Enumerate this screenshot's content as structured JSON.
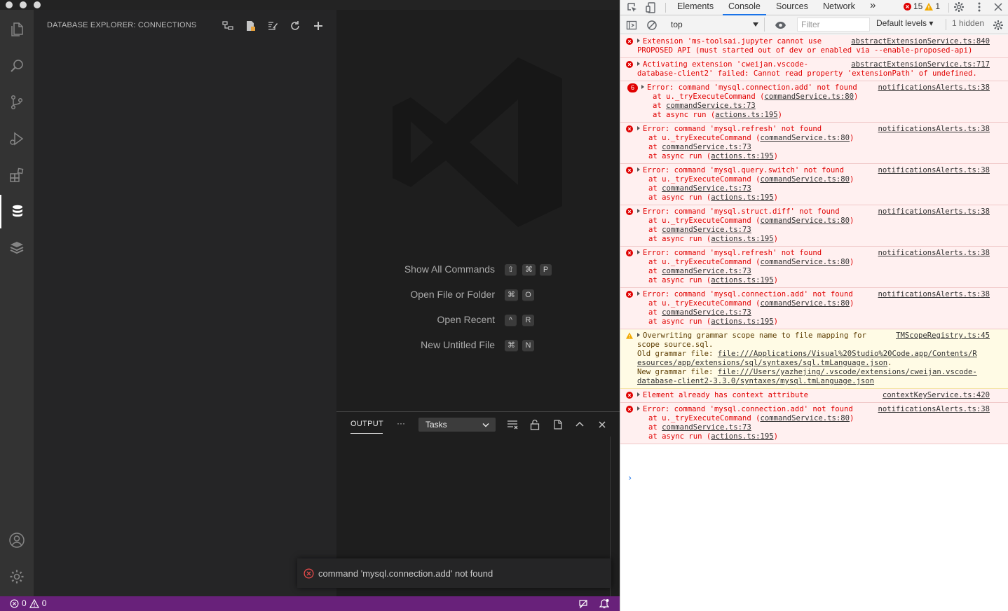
{
  "vscode": {
    "sidebar": {
      "title": "DATABASE EXPLORER: CONNECTIONS"
    },
    "commands": [
      {
        "label": "Show All Commands",
        "keys": [
          "⇧",
          "⌘",
          "P"
        ]
      },
      {
        "label": "Open File or Folder",
        "keys": [
          "⌘",
          "O"
        ]
      },
      {
        "label": "Open Recent",
        "keys": [
          "^",
          "R"
        ]
      },
      {
        "label": "New Untitled File",
        "keys": [
          "⌘",
          "N"
        ]
      }
    ],
    "panel": {
      "tab": "OUTPUT",
      "more": "···",
      "tasks_value": "Tasks"
    },
    "toast": {
      "message": "command 'mysql.connection.add' not found"
    },
    "status": {
      "errors": "0",
      "warnings": "0"
    }
  },
  "devtools": {
    "tabs": [
      "Elements",
      "Console",
      "Sources",
      "Network"
    ],
    "overflow": "»",
    "error_count": "15",
    "warning_count": "1",
    "context": "top",
    "filter_placeholder": "Filter",
    "levels": "Default levels ▾",
    "hidden": "1 hidden",
    "messages": [
      {
        "type": "error",
        "source": "abstractExtensionService.ts:840",
        "lines": [
          "Extension 'ms-toolsai.jupyter cannot use",
          "PROPOSED API (must started out of dev or enabled via --enable-proposed-api)"
        ]
      },
      {
        "type": "error",
        "source": "abstractExtensionService.ts:717",
        "lines": [
          "Activating extension 'cweijan.vscode-",
          "database-client2' failed: Cannot read property 'extensionPath' of undefined."
        ]
      },
      {
        "type": "error",
        "count": "6",
        "source": "notificationsAlerts.ts:38",
        "lines": [
          "Error: command 'mysql.connection.add' not found",
          "    at u._tryExecuteCommand (commandService.ts:80)",
          "    at commandService.ts:73",
          "    at async run (actions.ts:195)"
        ]
      },
      {
        "type": "error",
        "source": "notificationsAlerts.ts:38",
        "lines": [
          "Error: command 'mysql.refresh' not found",
          "    at u._tryExecuteCommand (commandService.ts:80)",
          "    at commandService.ts:73",
          "    at async run (actions.ts:195)"
        ]
      },
      {
        "type": "error",
        "source": "notificationsAlerts.ts:38",
        "lines": [
          "Error: command 'mysql.query.switch' not found",
          "    at u._tryExecuteCommand (commandService.ts:80)",
          "    at commandService.ts:73",
          "    at async run (actions.ts:195)"
        ]
      },
      {
        "type": "error",
        "source": "notificationsAlerts.ts:38",
        "lines": [
          "Error: command 'mysql.struct.diff' not found",
          "    at u._tryExecuteCommand (commandService.ts:80)",
          "    at commandService.ts:73",
          "    at async run (actions.ts:195)"
        ]
      },
      {
        "type": "error",
        "source": "notificationsAlerts.ts:38",
        "lines": [
          "Error: command 'mysql.refresh' not found",
          "    at u._tryExecuteCommand (commandService.ts:80)",
          "    at commandService.ts:73",
          "    at async run (actions.ts:195)"
        ]
      },
      {
        "type": "error",
        "source": "notificationsAlerts.ts:38",
        "lines": [
          "Error: command 'mysql.connection.add' not found",
          "    at u._tryExecuteCommand (commandService.ts:80)",
          "    at commandService.ts:73",
          "    at async run (actions.ts:195)"
        ]
      },
      {
        "type": "warning",
        "source": "TMScopeRegistry.ts:45",
        "lines": [
          "Overwriting grammar scope name to file mapping for",
          "scope source.sql.",
          "Old grammar file: file:///Applications/Visual%20Studio%20Code.app/Contents/R",
          "esources/app/extensions/sql/syntaxes/sql.tmLanguage.json.",
          "New grammar file: file:///Users/yazhejing/.vscode/extensions/cweijan.vscode-",
          "database-client2-3.3.0/syntaxes/mysql.tmLanguage.json"
        ]
      },
      {
        "type": "error",
        "source": "contextKeyService.ts:420",
        "lines": [
          "Element already has context attribute"
        ]
      },
      {
        "type": "error",
        "source": "notificationsAlerts.ts:38",
        "lines": [
          "Error: command 'mysql.connection.add' not found",
          "    at u._tryExecuteCommand (commandService.ts:80)",
          "    at commandService.ts:73",
          "    at async run (actions.ts:195)"
        ]
      }
    ],
    "prompt": "›"
  }
}
